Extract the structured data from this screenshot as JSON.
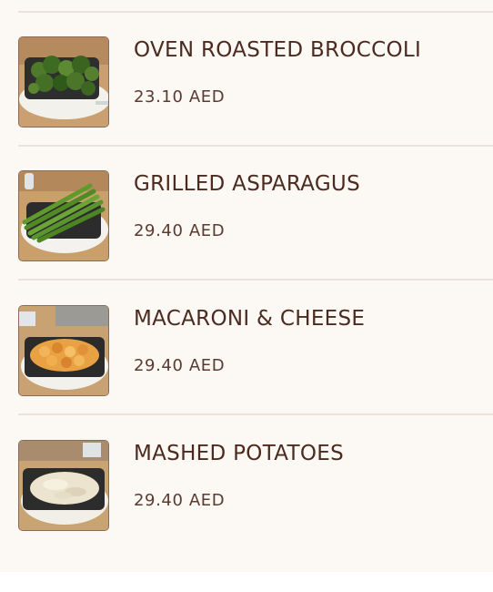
{
  "menu": {
    "items": [
      {
        "name": "OVEN ROASTED BROCCOLI",
        "price": "23.10 AED",
        "image_icon": "broccoli-dish-icon"
      },
      {
        "name": "GRILLED ASPARAGUS",
        "price": "29.40 AED",
        "image_icon": "asparagus-dish-icon"
      },
      {
        "name": "MACARONI & CHEESE",
        "price": "29.40 AED",
        "image_icon": "mac-cheese-dish-icon"
      },
      {
        "name": "MASHED POTATOES",
        "price": "29.40 AED",
        "image_icon": "mashed-potatoes-dish-icon"
      }
    ]
  },
  "colors": {
    "background": "#fcf8f4",
    "title": "#4b2a1f",
    "divider": "#e9e3dc"
  }
}
